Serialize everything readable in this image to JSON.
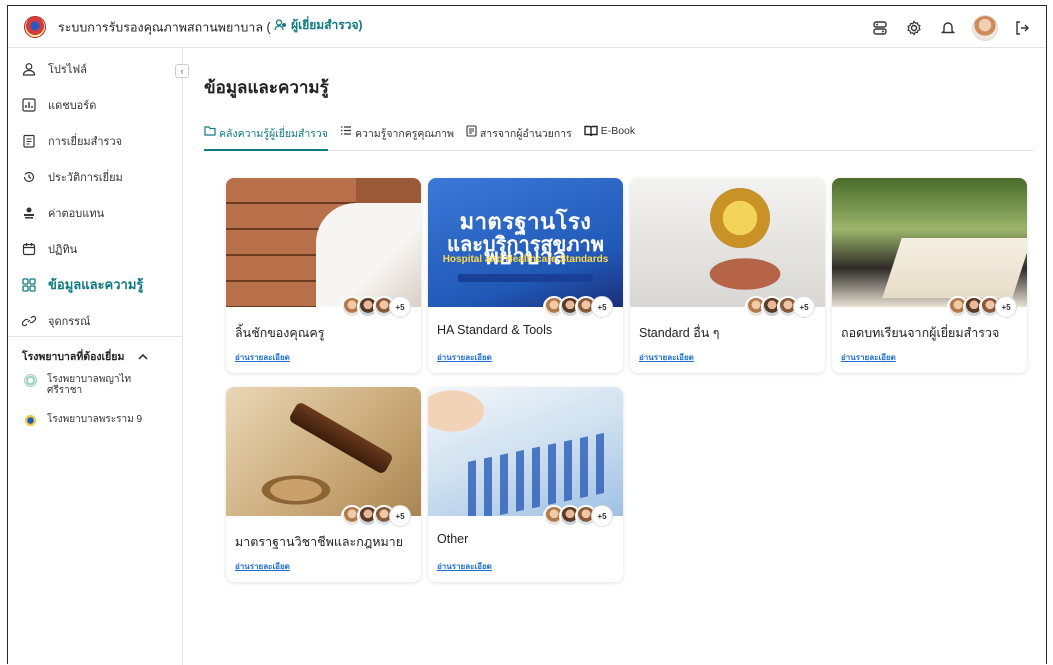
{
  "app": {
    "title": "ระบบการรับรองคุณภาพสถานพยาบาล (",
    "role": "ผู้เยี่ยมสำรวจ)"
  },
  "sidebar": {
    "items": [
      {
        "label": "โปรไฟล์",
        "icon": "user-icon"
      },
      {
        "label": "แดชบอร์ด",
        "icon": "chart-icon"
      },
      {
        "label": "การเยี่ยมสำรวจ",
        "icon": "clipboard-icon"
      },
      {
        "label": "ประวัติการเยี่ยม",
        "icon": "history-icon"
      },
      {
        "label": "ค่าตอบแทน",
        "icon": "money-icon"
      },
      {
        "label": "ปฏิทิน",
        "icon": "calendar-icon"
      },
      {
        "label": "ข้อมูลและความรู้",
        "icon": "grid-icon"
      },
      {
        "label": "จุดกรรณ์",
        "icon": "link-icon"
      }
    ],
    "section_title": "โรงพยาบาลที่ต้องเยี่ยม",
    "hospitals": [
      {
        "name_l1": "โรงพยาบาลพญาไท",
        "name_l2": "ศรีราชา"
      },
      {
        "name_l1": "โรงพยาบาลพระราม 9",
        "name_l2": ""
      }
    ]
  },
  "main": {
    "title": "ข้อมูลและความรู้",
    "tabs": [
      {
        "label": "คลังความรู้ผู้เยี่ยมสำรวจ",
        "icon": "folder-icon"
      },
      {
        "label": "ความรู้จากครูคุณภาพ",
        "icon": "list-icon"
      },
      {
        "label": "สารจากผู้อำนวยการ",
        "icon": "document-icon"
      },
      {
        "label": "E-Book",
        "icon": "book-icon"
      }
    ],
    "read_more": "อ่านรายละเอียด",
    "more_count": "+5",
    "cards": [
      {
        "title": "ลิ้นชักของคุณครู"
      },
      {
        "title": "HA Standard & Tools"
      },
      {
        "title": "Standard อื่น ๆ"
      },
      {
        "title": "ถอดบทเรียนจากผู้เยี่ยมสำรวจ"
      },
      {
        "title": "มาตราฐานวิชาชีพและกฎหมาย"
      },
      {
        "title": "Other"
      }
    ],
    "ha_image": {
      "line1": "มาตรฐานโรงพยาบาล",
      "line2": "และบริการสุขภาพ",
      "line3": "Hospital and Healthcare Standards"
    }
  },
  "colors": {
    "accent": "#0f7a83",
    "link": "#1f6fd1"
  }
}
